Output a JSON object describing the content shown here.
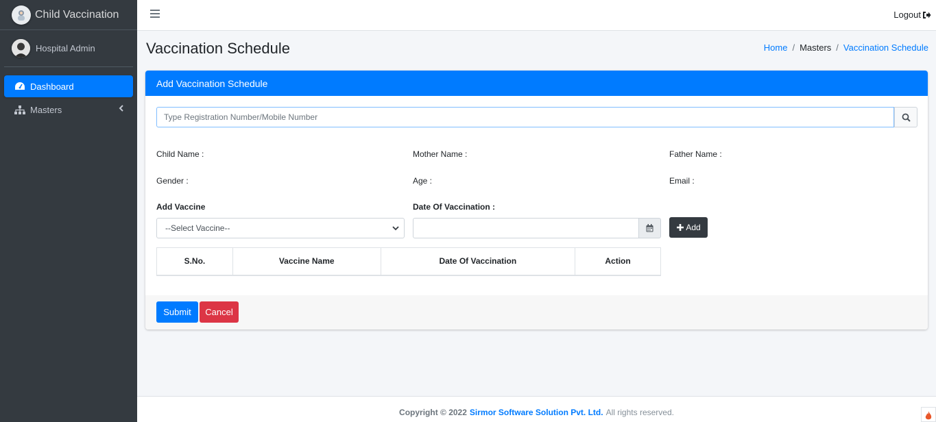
{
  "brand": {
    "title": "Child Vaccination",
    "logo_icon": "child-doctor-logo-icon"
  },
  "user": {
    "name": "Hospital Admin",
    "avatar_icon": "user-avatar-icon"
  },
  "nav": {
    "items": [
      {
        "label": "Dashboard",
        "icon": "tachometer-icon",
        "active": true
      },
      {
        "label": "Masters",
        "icon": "sitemap-icon",
        "active": false,
        "has_submenu": true
      }
    ]
  },
  "topbar": {
    "logout_label": "Logout"
  },
  "page": {
    "title": "Vaccination Schedule",
    "breadcrumb": [
      "Home",
      "Masters",
      "Vaccination Schedule"
    ]
  },
  "card": {
    "header": "Add Vaccination Schedule",
    "search": {
      "placeholder": "Type Registration Number/Mobile Number",
      "value": ""
    },
    "info": {
      "child_name": "Child Name :",
      "mother_name": "Mother Name :",
      "father_name": "Father Name :",
      "gender": "Gender :",
      "age": "Age :",
      "email": "Email :"
    },
    "add_vaccine_label": "Add Vaccine",
    "date_label": "Date Of Vaccination :",
    "vaccine_select": {
      "selected": "--Select Vaccine--"
    },
    "date_value": "",
    "add_button": "Add",
    "table": {
      "columns": [
        "S.No.",
        "Vaccine Name",
        "Date Of Vaccination",
        "Action"
      ],
      "rows": []
    },
    "submit_label": "Submit",
    "cancel_label": "Cancel"
  },
  "footer": {
    "prefix": "Copyright © 2022",
    "company": "Sirmor Software Solution Pvt. Ltd.",
    "suffix": "All rights reserved."
  },
  "colors": {
    "primary": "#007bff",
    "danger": "#dc3545",
    "dark": "#343a40",
    "sidebar": "#343a40"
  }
}
